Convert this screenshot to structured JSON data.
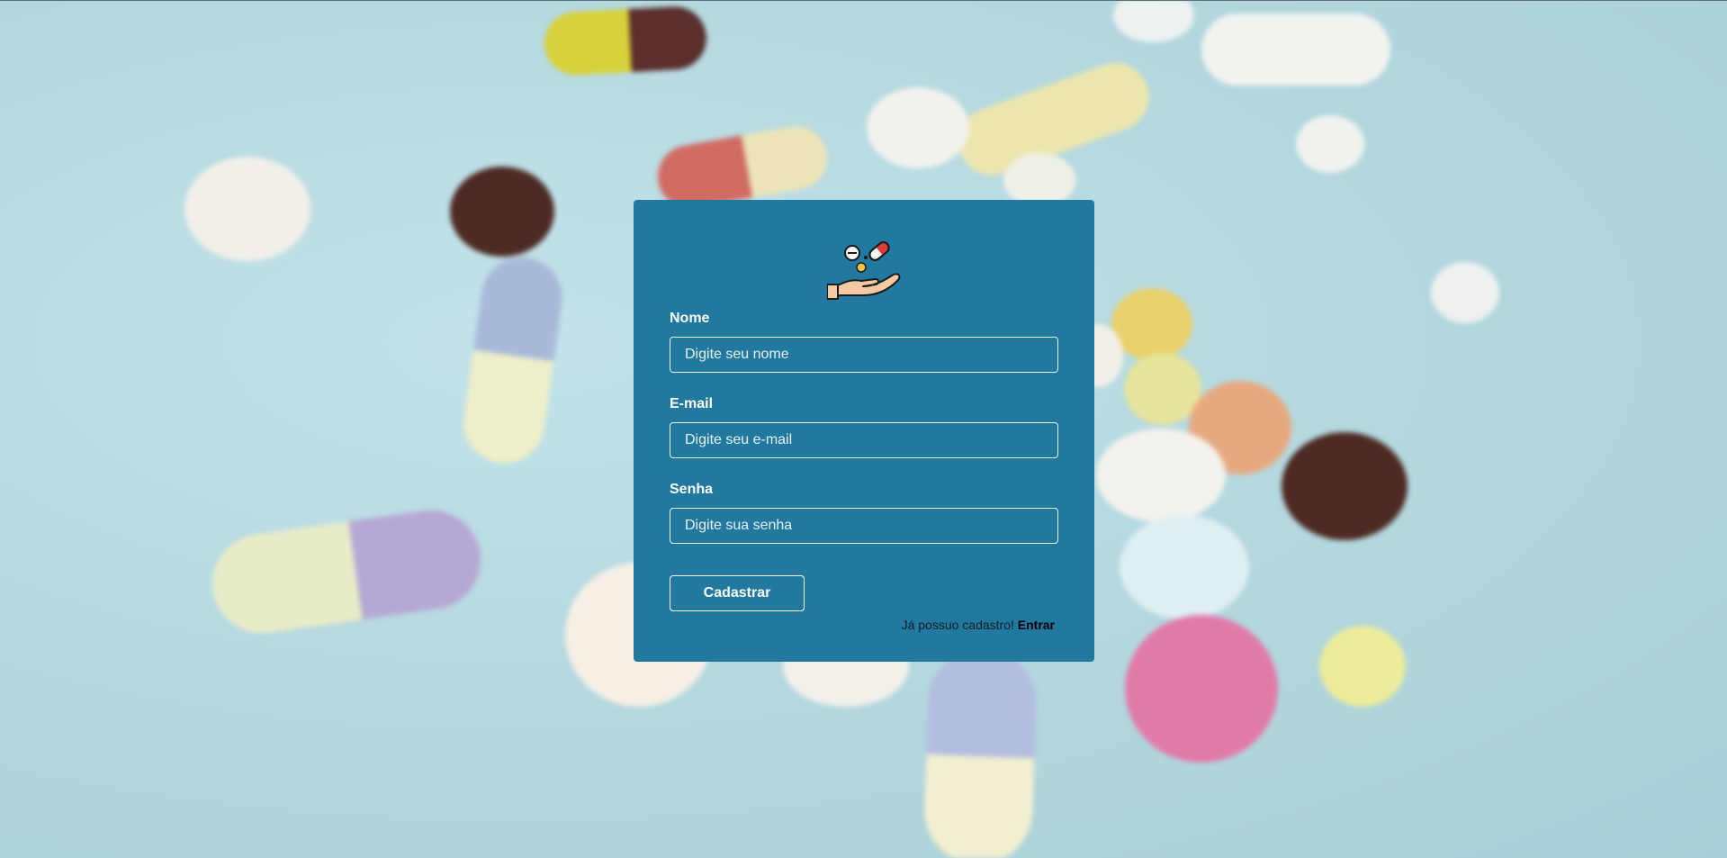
{
  "background": {
    "description_icon": "pills-background"
  },
  "card": {
    "logo_icon": "hand-receiving-pills-icon",
    "fields": [
      {
        "label": "Nome",
        "placeholder": "Digite seu nome",
        "value": ""
      },
      {
        "label": "E-mail",
        "placeholder": "Digite seu e-mail",
        "value": ""
      },
      {
        "label": "Senha",
        "placeholder": "Digite sua senha",
        "value": ""
      }
    ],
    "submit_label": "Cadastrar",
    "footer_text": "Já possuo cadastro! ",
    "footer_link": "Entrar"
  },
  "colors": {
    "card_background": "#22799f",
    "page_background": "#b9dde4"
  }
}
